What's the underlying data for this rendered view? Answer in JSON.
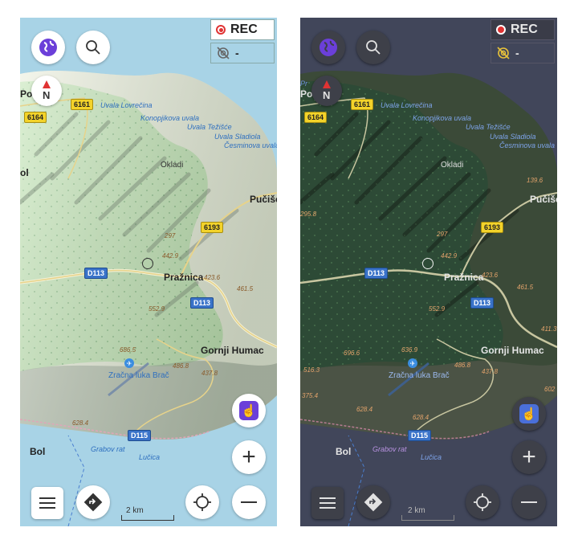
{
  "rec": {
    "label": "REC",
    "secondary": "-"
  },
  "compass": {
    "letter": "N"
  },
  "scale": {
    "label": "2 km"
  },
  "places": {
    "towns": [
      "Pučišća",
      "Pražnica",
      "Gornji Humac",
      "Bol",
      "Po",
      "ol",
      "Pr"
    ],
    "villages": [
      "Okladi"
    ],
    "bays": [
      "Uvala Lovrečina",
      "Konopjikova uvala",
      "Uvala Težišće",
      "Uvala Sladiola",
      "Česminova uvala",
      "Grabov rat",
      "Lučica"
    ],
    "airport": "Zračna luka Brač",
    "roads": [
      "6161",
      "6164",
      "6193",
      "D113",
      "D113",
      "D115"
    ],
    "elevations": [
      "139.6",
      "295.8",
      "442.9",
      "423.6",
      "461.5",
      "552.9",
      "411.3",
      "636.9",
      "686.5",
      "696.6",
      "516.3",
      "486.8",
      "437.8",
      "602",
      "375.4",
      "628.4",
      "297"
    ]
  },
  "themes": {
    "light": {
      "water": "#a8d3e6",
      "land": "#e8ecd7",
      "forest": "#a9d79d",
      "road": "#ffffff",
      "button": "#ffffff",
      "icon": "#333333",
      "accent": "#6b3fd9",
      "rec_bg": "#ffffff"
    },
    "dark": {
      "water": "#41465a",
      "land": "#3b4a38",
      "forest": "#2d4a36",
      "road": "#c8c6a0",
      "button": "#3e4049",
      "icon": "#e2e2e2",
      "accent": "#6b3fd9",
      "rec_bg": "#3a3c48"
    }
  }
}
